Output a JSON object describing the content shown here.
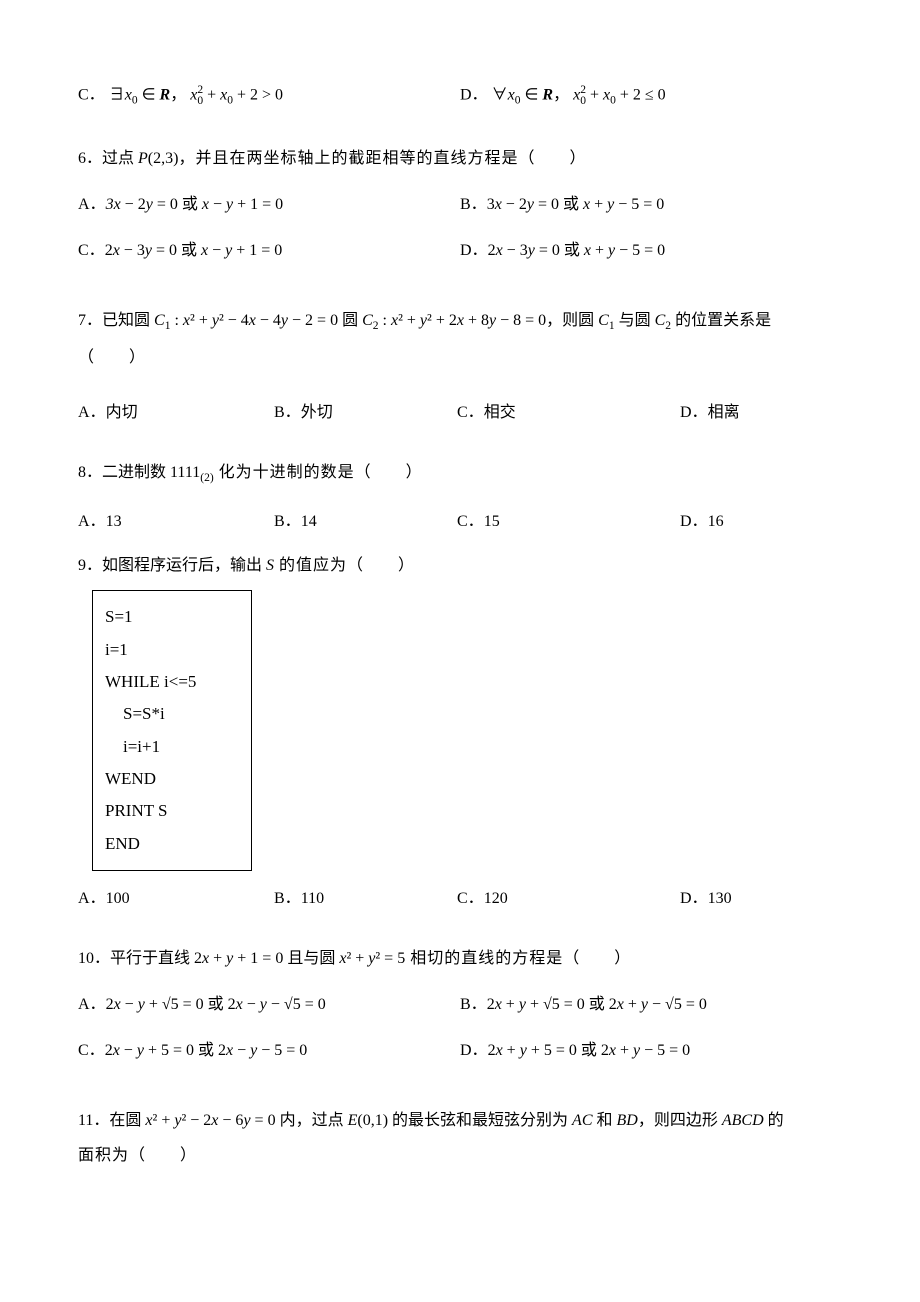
{
  "q5": {
    "optC_label": "C．",
    "optC_text1": "∃",
    "optC_var": "x",
    "optC_sub": "0",
    "optC_text2": " ∈ ",
    "optC_set": "R",
    "optC_text3": "，",
    "optC_expr_pre": "",
    "optC_var2": "x",
    "optC_sup1": "2",
    "optC_sub1": "0",
    "optC_plus": " + ",
    "optC_var3": "x",
    "optC_sub2": "0",
    "optC_tail": " + 2 > 0",
    "optD_label": "D．",
    "optD_text1": "∀",
    "optD_var": "x",
    "optD_sub": "0",
    "optD_text2": " ∈ ",
    "optD_set": "R",
    "optD_text3": "，",
    "optD_var2": "x",
    "optD_sup1": "2",
    "optD_sub1": "0",
    "optD_plus": " + ",
    "optD_var3": "x",
    "optD_sub2": "0",
    "optD_tail": " + 2 ≤ 0"
  },
  "q6": {
    "stem_pre": "6．过点 ",
    "stem_P": "P",
    "stem_paren_open": "(",
    "stem_args": "2,3",
    "stem_paren_close": ")",
    "stem_post": "，并且在两坐标轴上的截距相等的直线方程是（　　）",
    "optA_label": "A．",
    "optA_text": "3x − 2y = 0 或 x − y + 1 = 0",
    "optB_label": "B．",
    "optB_text": "3x − 2y = 0 或 x + y − 5 = 0",
    "optC_label": "C．",
    "optC_text": "2x − 3y = 0 或 x − y + 1 = 0",
    "optD_label": "D．",
    "optD_text": "2x − 3y = 0 或 x + y − 5 = 0"
  },
  "q7": {
    "stem_pre": "7．已知圆 ",
    "c1": "C",
    "c1_sub": "1",
    "c1_colon": " : ",
    "c1_eq": "x² + y² − 4x − 4y − 2 = 0",
    "mid": " 圆 ",
    "c2": "C",
    "c2_sub": "2",
    "c2_colon": " : ",
    "c2_eq": "x² + y² + 2x + 8y − 8 = 0",
    "post1": "，则圆 ",
    "post_c1": "C",
    "post_c1_sub": "1",
    "post2": " 与圆 ",
    "post_c2": "C",
    "post_c2_sub": "2",
    "post3": " 的位置关系是",
    "blank": "（　　）",
    "optA_label": "A．",
    "optA_text": "内切",
    "optB_label": "B．",
    "optB_text": "外切",
    "optC_label": "C．",
    "optC_text": "相交",
    "optD_label": "D．",
    "optD_text": "相离"
  },
  "q8": {
    "stem_pre": "8．二进制数 ",
    "num": "1111",
    "base": "(2)",
    "stem_post": " 化为十进制的数是（　　）",
    "optA_label": "A．",
    "optA_text": "13",
    "optB_label": "B．",
    "optB_text": "14",
    "optC_label": "C．",
    "optC_text": "15",
    "optD_label": "D．",
    "optD_text": "16"
  },
  "q9": {
    "stem_pre": "9．如图程序运行后，输出 ",
    "var_S": "S",
    "stem_post": " 的值应为（　　）",
    "code_l1": "S=1",
    "code_l2": "i=1",
    "code_l3": "WHILE  i<=5",
    "code_l4": "S=S*i",
    "code_l5": "i=i+1",
    "code_l6": "WEND",
    "code_l7": "PRINT  S",
    "code_l8": "END",
    "optA_label": "A．",
    "optA_text": "100",
    "optB_label": "B．",
    "optB_text": "110",
    "optC_label": "C．",
    "optC_text": "120",
    "optD_label": "D．",
    "optD_text": "130"
  },
  "q10": {
    "stem_pre": "10．平行于直线 ",
    "line_eq": "2x + y + 1 = 0",
    "mid": " 且与圆 ",
    "circle_eq": "x² + y² = 5",
    "stem_post": " 相切的直线的方程是（　　）",
    "optA_label": "A．",
    "optA_text": "2x − y + √5 = 0 或 2x − y − √5 = 0",
    "optB_label": "B．",
    "optB_text": "2x + y + √5 = 0 或 2x + y − √5 = 0",
    "optC_label": "C．",
    "optC_text": "2x − y + 5 = 0 或 2x − y − 5 = 0",
    "optD_label": "D．",
    "optD_text": "2x + y + 5 = 0 或 2x + y − 5 = 0"
  },
  "q11": {
    "stem_pre": "11．在圆 ",
    "circle": "x² + y² − 2x − 6y = 0",
    "mid1": " 内，过点 ",
    "E": "E",
    "E_open": "(",
    "E_args": "0,1",
    "E_close": ")",
    "mid2": " 的最长弦和最短弦分别为 ",
    "AC": "AC",
    "mid3": " 和 ",
    "BD": "BD",
    "mid4": "，则四边形 ",
    "ABCD": "ABCD",
    "mid5": " 的",
    "line2": "面积为（　　）"
  }
}
